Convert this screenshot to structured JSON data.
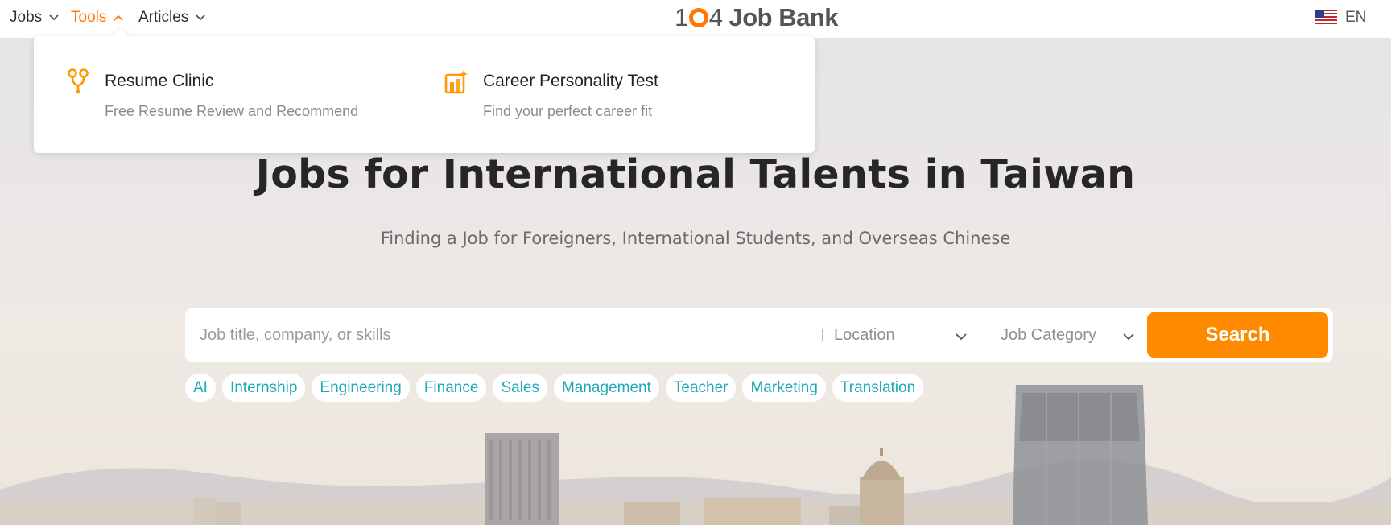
{
  "nav": {
    "items": [
      {
        "label": "Jobs",
        "active": false
      },
      {
        "label": "Tools",
        "active": true
      },
      {
        "label": "Articles",
        "active": false
      }
    ],
    "logo_digits_1": "1",
    "logo_digits_2": "4",
    "logo_text": "Job Bank",
    "lang": "EN"
  },
  "dropdown": {
    "items": [
      {
        "title": "Resume Clinic",
        "desc": "Free Resume Review and Recommend",
        "icon": "resume-clinic-icon"
      },
      {
        "title": "Career Personality Test",
        "desc": "Find your perfect career fit",
        "icon": "personality-test-icon"
      }
    ]
  },
  "hero": {
    "title": "Jobs for International Talents in Taiwan",
    "subtitle": "Finding a Job for Foreigners, International Students, and Overseas Chinese"
  },
  "search": {
    "placeholder": "Job title, company, or skills",
    "location": "Location",
    "category": "Job Category",
    "button": "Search"
  },
  "tags": [
    "AI",
    "Internship",
    "Engineering",
    "Finance",
    "Sales",
    "Management",
    "Teacher",
    "Marketing",
    "Translation"
  ],
  "colors": {
    "accent": "#ff7800",
    "button": "#ff8a00",
    "tag_text": "#1fa9b8",
    "headline": "#262626"
  }
}
